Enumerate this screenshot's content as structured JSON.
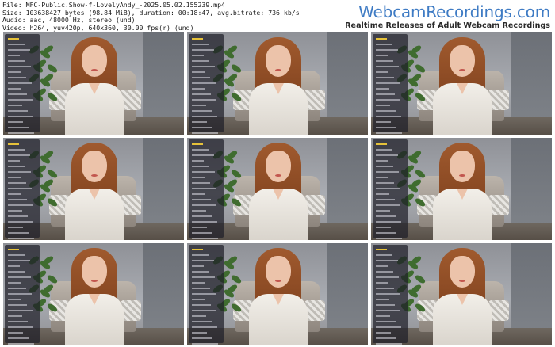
{
  "file_info": {
    "file": "File: MFC-Public.Show-f-LovelyAndy_-2025.05.02.155239.mp4",
    "size": "Size: 103638427 bytes (98.84 MiB), duration: 00:18:47, avg.bitrate: 736 kb/s",
    "audio": "Audio: aac, 48000 Hz, stereo (und)",
    "video": "Video: h264, yuv420p, 640x360, 30.00 fps(r) (und)"
  },
  "brand": {
    "name": "WebcamRecordings.com",
    "tagline": "Realtime Releases of Adult Webcam Recordings"
  },
  "thumbnails": [
    {
      "index": 1
    },
    {
      "index": 2
    },
    {
      "index": 3
    },
    {
      "index": 4
    },
    {
      "index": 5
    },
    {
      "index": 6
    },
    {
      "index": 7
    },
    {
      "index": 8
    },
    {
      "index": 9
    }
  ]
}
